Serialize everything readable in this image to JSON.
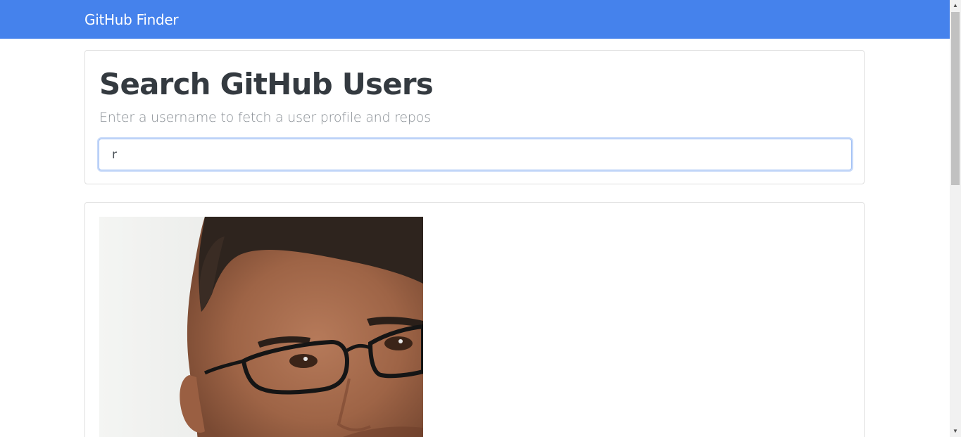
{
  "navbar": {
    "brand": "GitHub Finder",
    "color": "#4582ec"
  },
  "search": {
    "heading": "Search GitHub Users",
    "lead": "Enter a username to fetch a user profile and repos",
    "input_value": "r",
    "input_placeholder": ""
  },
  "profile": {
    "avatar_alt": "user avatar"
  },
  "scrollbar": {
    "up_arrow": "▲",
    "down_arrow": "▼"
  }
}
